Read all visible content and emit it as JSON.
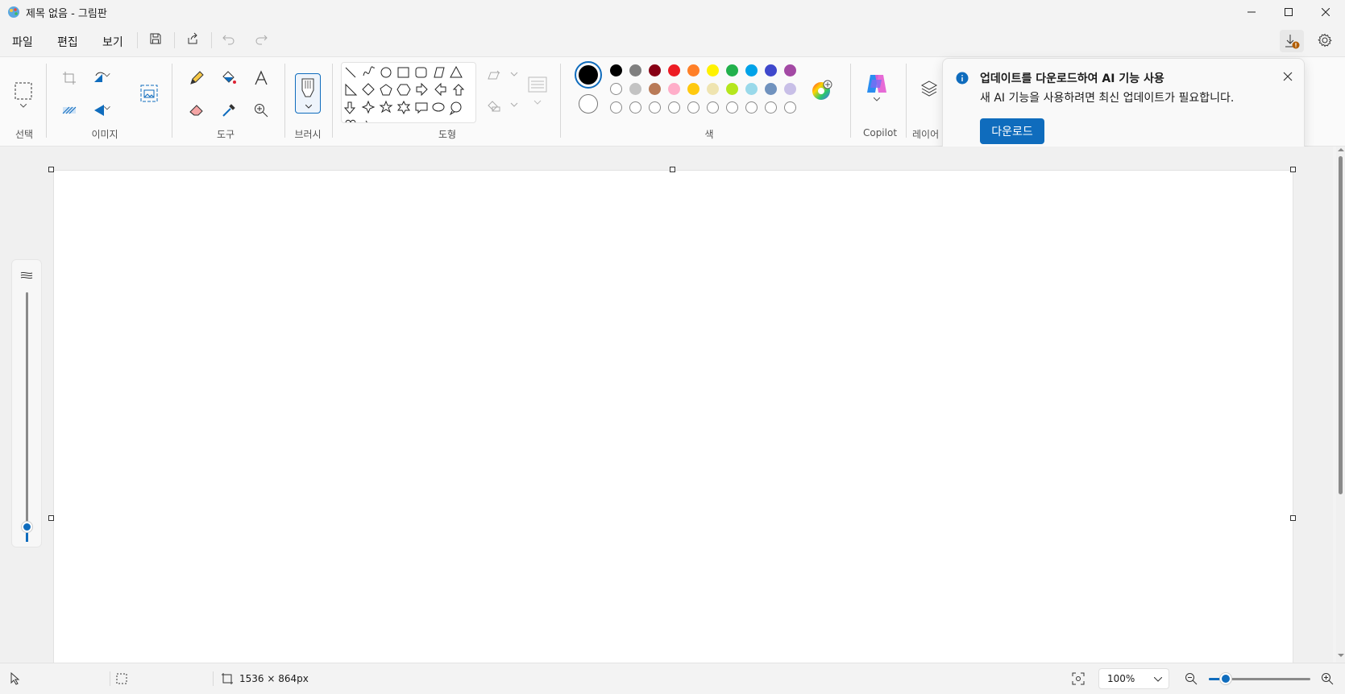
{
  "window": {
    "title": "제목 없음 - 그림판"
  },
  "menu": {
    "file": "파일",
    "edit": "편집",
    "view": "보기"
  },
  "ribbon": {
    "groups": {
      "select": "선택",
      "image": "이미지",
      "tools": "도구",
      "brushes": "브러시",
      "shapes": "도형",
      "colors": "색",
      "copilot": "Copilot",
      "layers": "레이어"
    },
    "palette_row1": [
      "#000000",
      "#7f7f7f",
      "#880015",
      "#ed1c24",
      "#ff7f27",
      "#fff200",
      "#22b14c",
      "#00a2e8",
      "#3f48cc",
      "#a349a4"
    ],
    "palette_row2": [
      "#ffffff",
      "#c3c3c3",
      "#b97a57",
      "#ffaec9",
      "#ffc90e",
      "#efe4b0",
      "#b5e61d",
      "#99d9ea",
      "#7092be",
      "#c8bfe7"
    ],
    "primary_color": "#000000",
    "secondary_color": "#ffffff"
  },
  "notification": {
    "title": "업데이트를 다운로드하여 AI 기능 사용",
    "body": "새 AI 기능을 사용하려면 최신 업데이트가 필요합니다.",
    "button": "다운로드"
  },
  "status": {
    "canvas_size": "1536 × 864px",
    "zoom": "100%",
    "zoom_slider_fraction": 0.17
  },
  "accent": "#0f6cbd"
}
